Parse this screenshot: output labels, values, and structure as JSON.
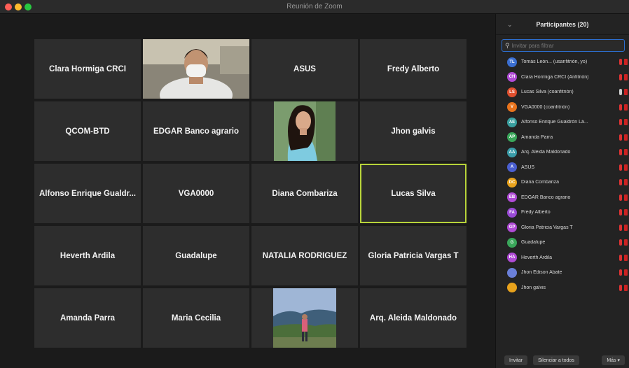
{
  "window": {
    "title": "Reunión de Zoom"
  },
  "tiles": [
    {
      "name": "Clara Hormiga CRCI"
    },
    {
      "name": "",
      "photo": "man-with-mask"
    },
    {
      "name": "ASUS"
    },
    {
      "name": "Fredy Alberto"
    },
    {
      "name": "QCOM-BTD"
    },
    {
      "name": "EDGAR Banco agrario"
    },
    {
      "name": "",
      "photo": "woman-portrait"
    },
    {
      "name": "Jhon galvis"
    },
    {
      "name": "Alfonso Enrique Gualdr..."
    },
    {
      "name": "VGA0000"
    },
    {
      "name": "Diana Combariza"
    },
    {
      "name": "Lucas Silva",
      "active": true
    },
    {
      "name": "Heverth Ardila"
    },
    {
      "name": "Guadalupe"
    },
    {
      "name": "NATALIA RODRIGUEZ"
    },
    {
      "name": "Gloria Patricia Vargas T"
    },
    {
      "name": "Amanda Parra"
    },
    {
      "name": "Maria Cecilia"
    },
    {
      "name": "",
      "photo": "person-landscape"
    },
    {
      "name": "Arq. Aleida Maldonado"
    }
  ],
  "panel": {
    "title": "Participantes (20)",
    "search_placeholder": "Invitar para filtrar",
    "participants": [
      {
        "initials": "TL",
        "name": "Tomás León... (usanfitrión, yo)",
        "color": "#3b6fd1",
        "mic": "off"
      },
      {
        "initials": "CH",
        "name": "Clara Hormiga CRCI (Anfitrión)",
        "color": "#b14bd6",
        "mic": "off"
      },
      {
        "initials": "LS",
        "name": "Lucas Silva (coanfitrión)",
        "color": "#e0502f",
        "mic": "on"
      },
      {
        "initials": "V",
        "name": "VGA0000 (coanfitrión)",
        "color": "#e8731c",
        "mic": "off"
      },
      {
        "initials": "AE",
        "name": "Alfonso Enrique Gualdrón Lá...",
        "color": "#3aa0a0",
        "mic": "off"
      },
      {
        "initials": "AP",
        "name": "Amanda Parra",
        "color": "#3aa65a",
        "mic": "off"
      },
      {
        "initials": "AA",
        "name": "Arq. Aleida Maldonado",
        "color": "#3a9ca8",
        "mic": "off"
      },
      {
        "initials": "A",
        "name": "ASUS",
        "color": "#4a5fd0",
        "mic": "off"
      },
      {
        "initials": "DC",
        "name": "Diana Combariza",
        "color": "#e8a21c",
        "mic": "off"
      },
      {
        "initials": "EB",
        "name": "EDGAR Banco agrario",
        "color": "#b14bd6",
        "mic": "off"
      },
      {
        "initials": "FA",
        "name": "Fredy Alberto",
        "color": "#9a4bd6",
        "mic": "off"
      },
      {
        "initials": "GP",
        "name": "Gloria Patricia Vargas T",
        "color": "#b14bd6",
        "mic": "off"
      },
      {
        "initials": "G",
        "name": "Guadalupe",
        "color": "#3aa65a",
        "mic": "off"
      },
      {
        "initials": "HA",
        "name": "Heverth Ardila",
        "color": "#b14bd6",
        "mic": "off"
      },
      {
        "initials": "",
        "name": "Jhon Edison Abate",
        "color": "#6a7fd8",
        "mic": "off"
      },
      {
        "initials": "",
        "name": "Jhon galvis",
        "color": "#e8a21c",
        "mic": "off"
      }
    ],
    "buttons": {
      "invite": "Invitar",
      "mute_all": "Silenciar a todos",
      "more": "Más ▾"
    }
  }
}
